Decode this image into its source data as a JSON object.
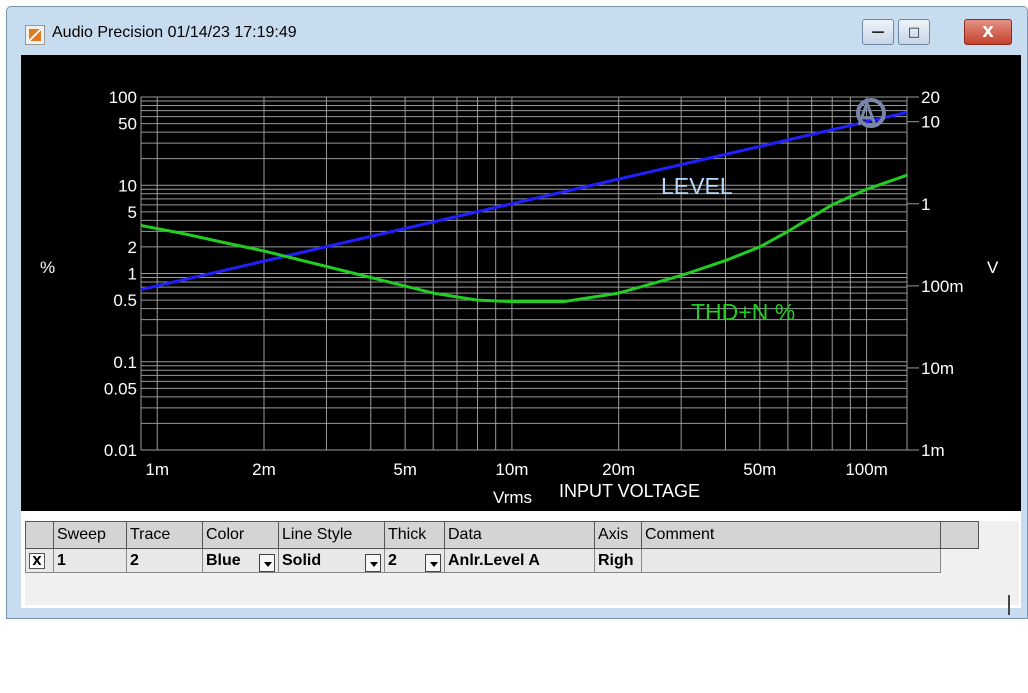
{
  "window": {
    "title": "Audio Precision  01/14/23 17:19:49"
  },
  "controls": {
    "minimize": "—",
    "maximize": "□",
    "close": "X"
  },
  "colors": {
    "plot_bg": "#000000",
    "grid": "#9a9a9a",
    "level": "#2020ff",
    "thd": "#22cc22",
    "axis_text": "#ffffff",
    "level_label": "#b8d8f8",
    "thd_label": "#22cc22"
  },
  "chart_data": {
    "type": "line",
    "xlabel": "Vrms",
    "xlabel_extra": "INPUT VOLTAGE",
    "ylabel_left": "%",
    "ylabel_right": "V",
    "x_scale": "log",
    "y_left_scale": "log",
    "y_right_scale": "log",
    "xlim": [
      0.0009,
      0.13
    ],
    "ylim_left": [
      0.01,
      100
    ],
    "ylim_right": [
      0.001,
      20
    ],
    "grid": true,
    "x_ticks": [
      {
        "value": 0.001,
        "label": "1m"
      },
      {
        "value": 0.002,
        "label": "2m"
      },
      {
        "value": 0.005,
        "label": "5m"
      },
      {
        "value": 0.01,
        "label": "10m"
      },
      {
        "value": 0.02,
        "label": "20m"
      },
      {
        "value": 0.05,
        "label": "50m"
      },
      {
        "value": 0.1,
        "label": "100m"
      }
    ],
    "y_left_ticks": [
      {
        "value": 100,
        "label": "100"
      },
      {
        "value": 50,
        "label": "50"
      },
      {
        "value": 10,
        "label": "10"
      },
      {
        "value": 5,
        "label": "5"
      },
      {
        "value": 2,
        "label": "2"
      },
      {
        "value": 1,
        "label": "1"
      },
      {
        "value": 0.5,
        "label": "0.5"
      },
      {
        "value": 0.1,
        "label": "0.1"
      },
      {
        "value": 0.05,
        "label": "0.05"
      },
      {
        "value": 0.01,
        "label": "0.01"
      }
    ],
    "y_right_ticks": [
      {
        "value": 20,
        "label": "20"
      },
      {
        "value": 10,
        "label": "10"
      },
      {
        "value": 1,
        "label": "1"
      },
      {
        "value": 0.1,
        "label": "100m"
      },
      {
        "value": 0.01,
        "label": "10m"
      },
      {
        "value": 0.001,
        "label": "1m"
      }
    ],
    "series": [
      {
        "name": "LEVEL",
        "axis": "right",
        "color": "#2020ff",
        "x": [
          0.0009,
          0.13
        ],
        "y": [
          0.09,
          13
        ]
      },
      {
        "name": "THD+N %",
        "axis": "left",
        "color": "#22cc22",
        "x": [
          0.0009,
          0.0012,
          0.0015,
          0.002,
          0.003,
          0.004,
          0.005,
          0.006,
          0.008,
          0.01,
          0.014,
          0.02,
          0.03,
          0.04,
          0.05,
          0.06,
          0.08,
          0.1,
          0.13
        ],
        "y": [
          3.5,
          2.8,
          2.3,
          1.8,
          1.2,
          0.9,
          0.72,
          0.6,
          0.5,
          0.48,
          0.48,
          0.6,
          0.95,
          1.4,
          2.0,
          3.0,
          6.0,
          9.0,
          13.0
        ]
      }
    ]
  },
  "table": {
    "headers": [
      "",
      "Sweep",
      "Trace",
      "Color",
      "Line Style",
      "Thick",
      "Data",
      "Axis",
      "Comment",
      ""
    ],
    "row": {
      "checked": "X",
      "sweep": "1",
      "trace": "2",
      "color": "Blue",
      "line_style": "Solid",
      "thick": "2",
      "data": "Anlr.Level A",
      "axis": "Righ",
      "comment": ""
    }
  }
}
